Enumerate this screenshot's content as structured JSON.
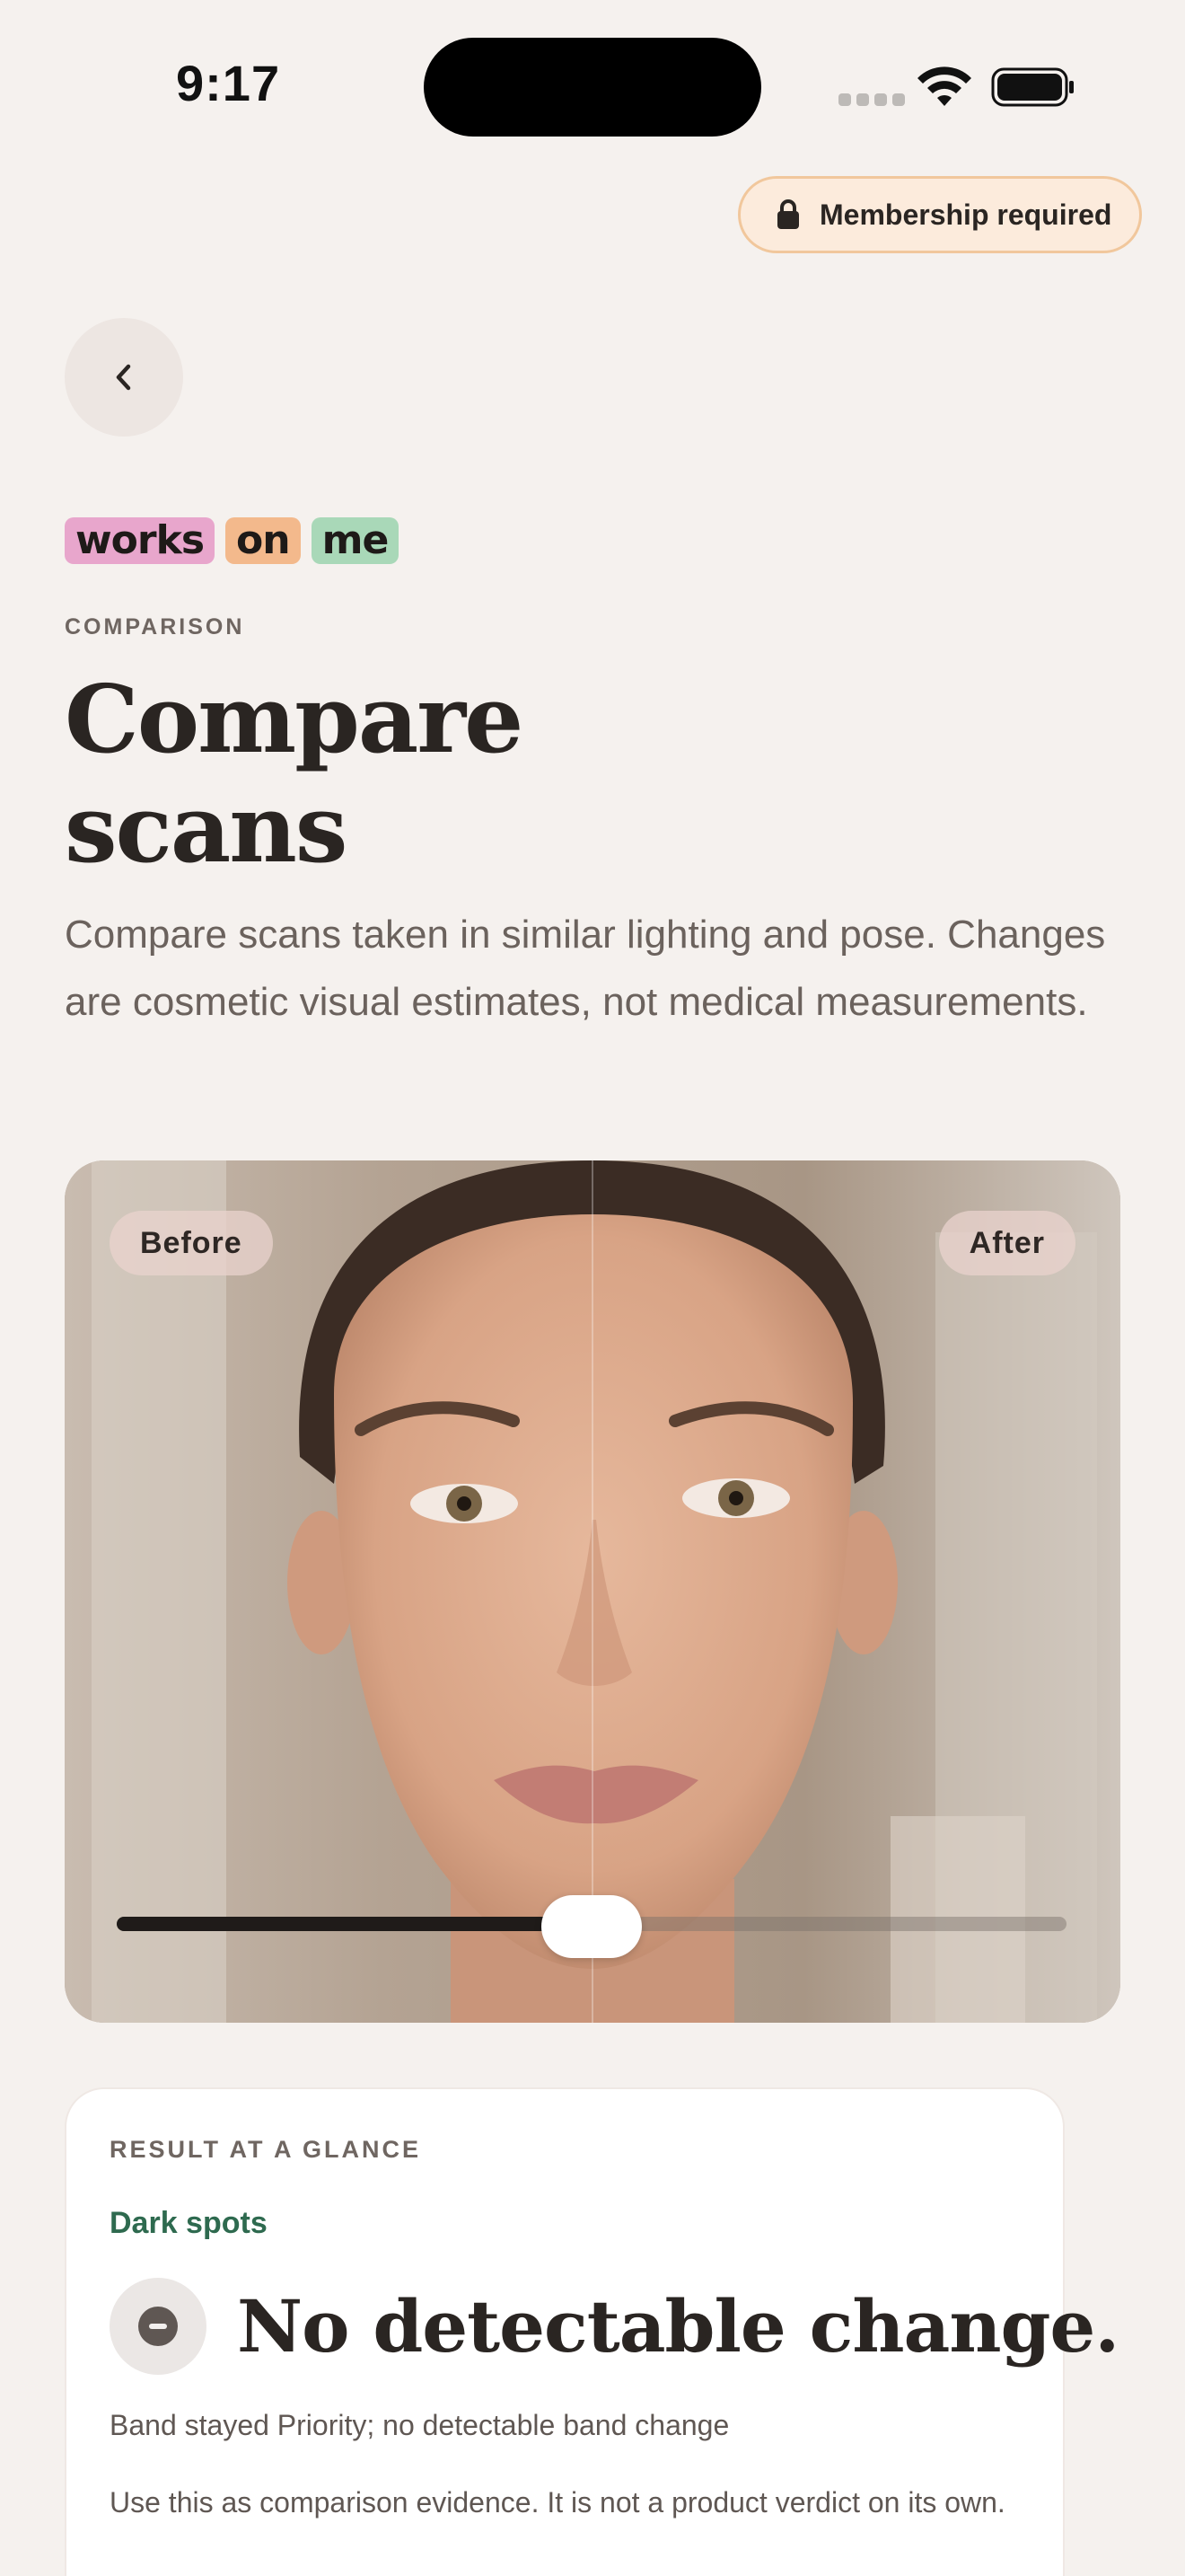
{
  "status_bar": {
    "time": "9:17"
  },
  "membership": {
    "label": "Membership required"
  },
  "brand": {
    "words": [
      {
        "text": "works",
        "color": "#e8a6cc"
      },
      {
        "text": "on",
        "color": "#f3b98c"
      },
      {
        "text": "me",
        "color": "#a9d8b8"
      }
    ]
  },
  "header": {
    "eyebrow": "COMPARISON",
    "title": "Compare scans",
    "description": "Compare scans taken in similar lighting and pose. Changes are cosmetic visual estimates, not medical measurements."
  },
  "comparison": {
    "before_label": "Before",
    "after_label": "After",
    "slider_position": 0.5
  },
  "result": {
    "eyebrow": "RESULT AT A GLANCE",
    "category": "Dark spots",
    "headline": "No detectable change.",
    "band_text": "Band stayed Priority; no detectable band change",
    "note": "Use this as comparison evidence. It is not a product verdict on its own."
  },
  "colors": {
    "background": "#f5f1ee",
    "accent_green": "#2e6a4f",
    "pill_border": "#f1c79c",
    "pill_fill": "#fcebdc"
  }
}
